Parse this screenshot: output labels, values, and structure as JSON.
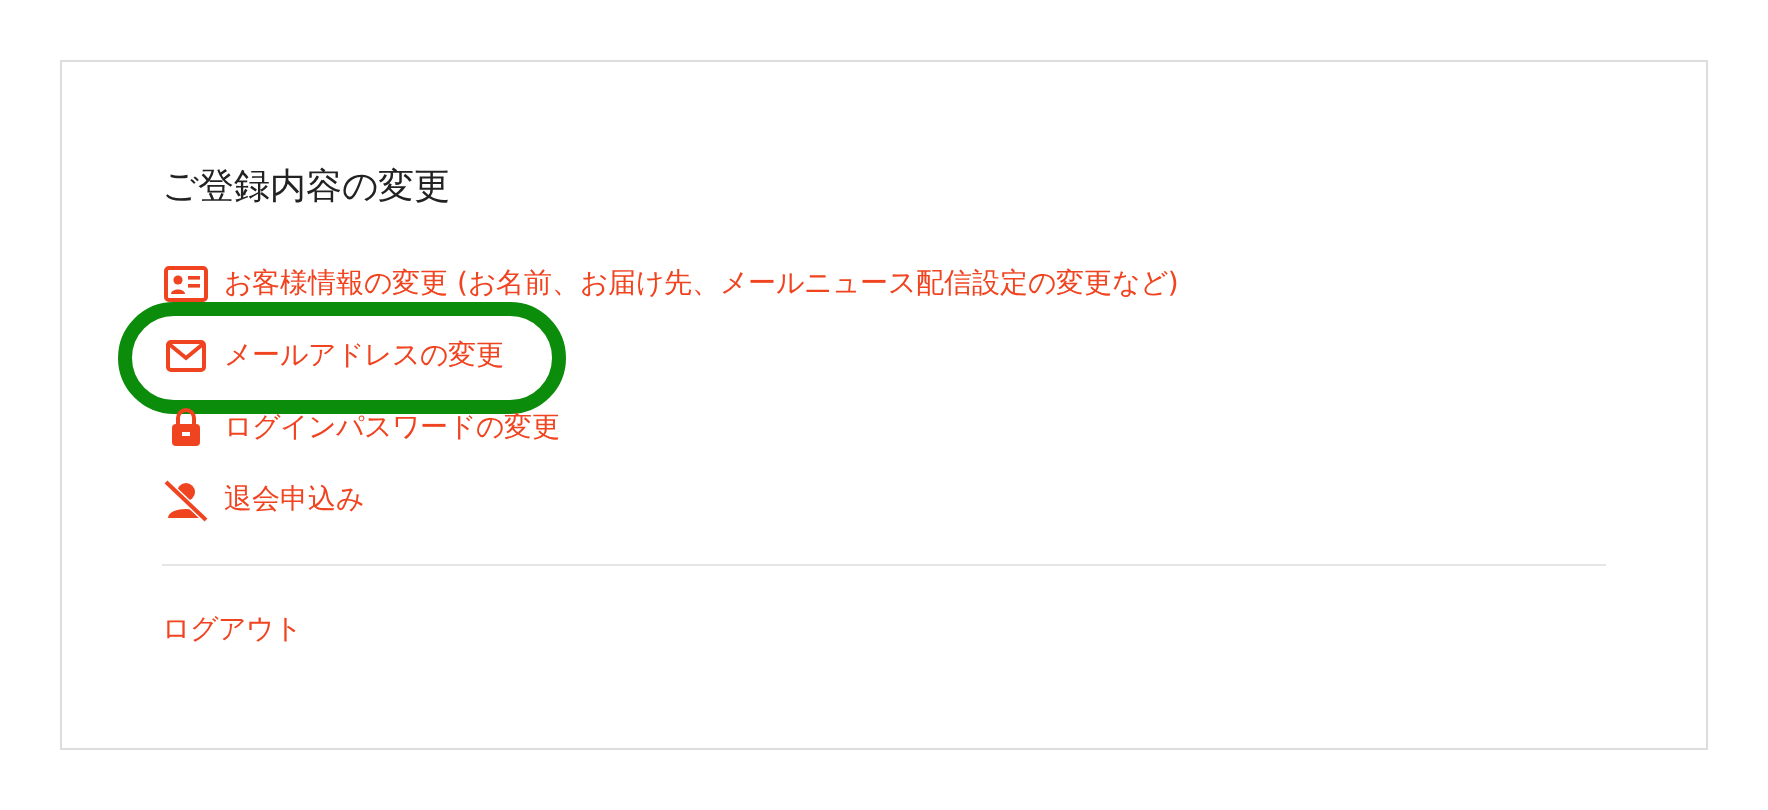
{
  "section": {
    "title": "ご登録内容の変更",
    "links": [
      {
        "kind": "profile",
        "label": "お客様情報の変更 (お名前、お届け先、メールニュース配信設定の変更など)",
        "highlighted": false
      },
      {
        "kind": "mail",
        "label": "メールアドレスの変更",
        "highlighted": true
      },
      {
        "kind": "lock",
        "label": "ログインパスワードの変更",
        "highlighted": false
      },
      {
        "kind": "withdraw",
        "label": "退会申込み",
        "highlighted": false
      }
    ],
    "logout": "ログアウト"
  }
}
